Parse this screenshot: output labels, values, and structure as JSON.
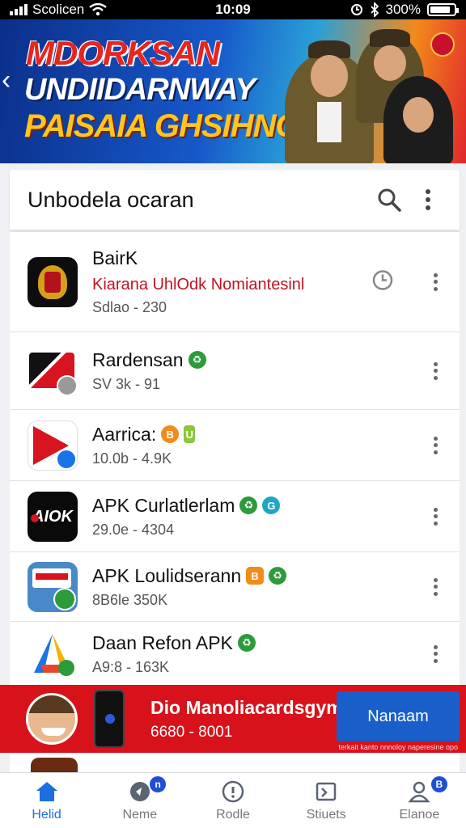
{
  "status_bar": {
    "carrier": "Scolicen",
    "time": "10:09",
    "battery_text": "300%",
    "battery_level": 0.85
  },
  "banner": {
    "line1": "MDORKSAN",
    "line2": "UNDIIDARNWAY",
    "line3": "PAISAIA GHSIHNGI",
    "colors": {
      "red": "#e8241f",
      "yellow": "#ffc51f",
      "blue": "#0b2f8a"
    }
  },
  "header": {
    "title": "Unbodela ocaran",
    "search_icon": "search-icon",
    "more_icon": "more-vert-icon"
  },
  "apps": [
    {
      "name": "BairK",
      "subtitle": "Kiarana UhlOdk Nomiantesinl",
      "meta": "Sdlao - 230",
      "badges": [],
      "status_icon": "clock-icon"
    },
    {
      "name": "Rardensan",
      "subtitle": "",
      "meta": "SV 3k - 91",
      "badges": [
        {
          "glyph": "♻",
          "color": "#2e9b3a"
        }
      ]
    },
    {
      "name": "Aarrica:",
      "subtitle": "",
      "meta": "10.0b - 4.9K",
      "badges": [
        {
          "glyph": "B",
          "color": "#f08c1a"
        },
        {
          "glyph": "U",
          "color": "#8cc63f"
        }
      ]
    },
    {
      "name": "APK Curlatlerlam",
      "subtitle": "",
      "meta": "29.0e - 4304",
      "badges": [
        {
          "glyph": "♻",
          "color": "#2e9b3a"
        },
        {
          "glyph": "G",
          "color": "#1ea7c5"
        }
      ]
    },
    {
      "name": "APK Loulidserann",
      "subtitle": "",
      "meta": "8B6le 350K",
      "badges": [
        {
          "glyph": "B",
          "color": "#f08c1a"
        },
        {
          "glyph": "♻",
          "color": "#2e9b3a"
        }
      ]
    },
    {
      "name": "Daan Refon APK",
      "subtitle": "",
      "meta": "A9:8 - 163K",
      "badges": [
        {
          "glyph": "♻",
          "color": "#2e9b3a"
        }
      ]
    }
  ],
  "app_icon_names": [
    "police-emblem-icon",
    "flag-tile-icon",
    "red-arrow-icon",
    "aiok-logo-icon",
    "map-tile-icon",
    "triangle-logo-icon"
  ],
  "ad": {
    "title": "Dio Manoliacardsgym",
    "subtitle": "6680 - 8001",
    "button_label": "Nanaam",
    "fine_print": "terkait kanto nnnoloy naperesine opo"
  },
  "bottom_nav": [
    {
      "label": "Helid",
      "icon": "home-icon",
      "active": true,
      "badge": ""
    },
    {
      "label": "Neme",
      "icon": "compass-icon",
      "active": false,
      "badge": "n"
    },
    {
      "label": "Rodle",
      "icon": "info-circle-icon",
      "active": false,
      "badge": ""
    },
    {
      "label": "Stiuets",
      "icon": "window-icon",
      "active": false,
      "badge": ""
    },
    {
      "label": "Elanoe",
      "icon": "profile-icon",
      "active": false,
      "badge": "B"
    }
  ],
  "colors": {
    "accent": "#1c6fe0",
    "ad_red": "#d8121b",
    "subtitle_red": "#c1121f"
  }
}
